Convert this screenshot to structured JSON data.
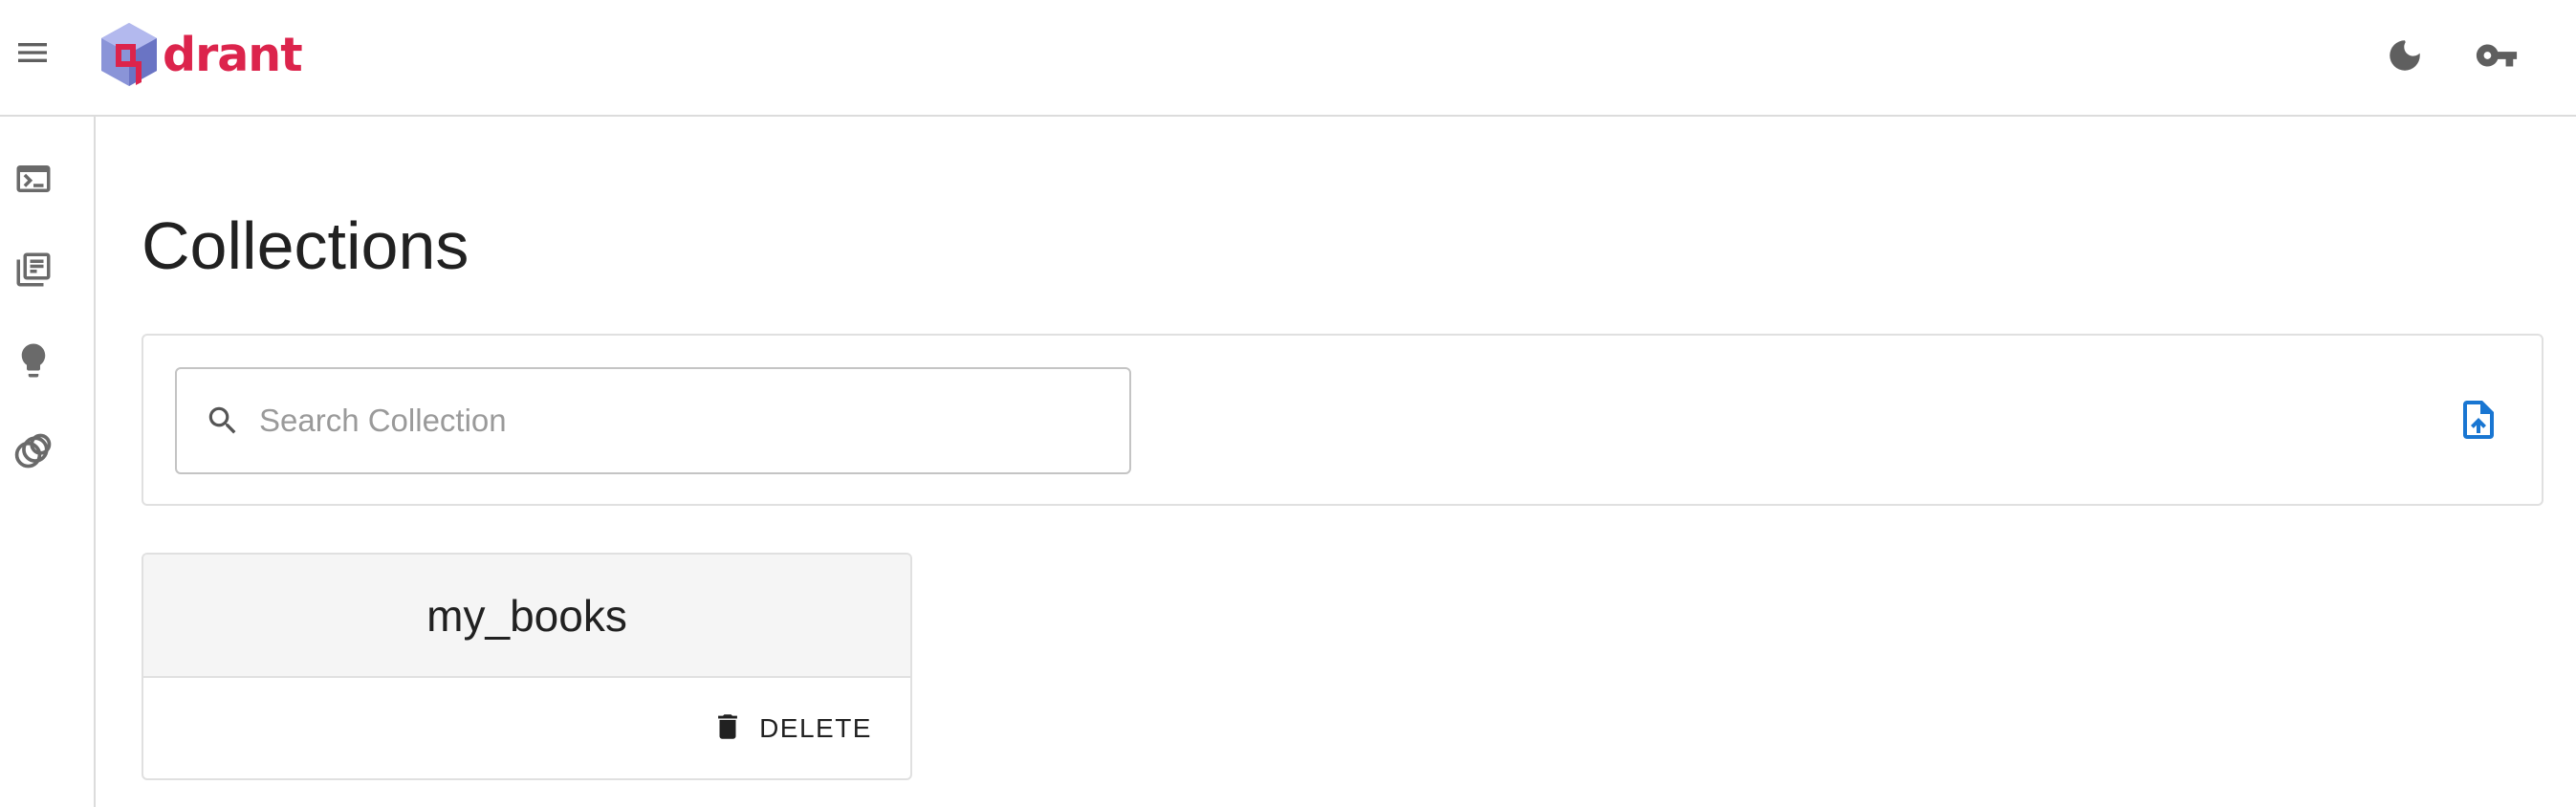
{
  "header": {
    "logo_text": "drant",
    "icons": {
      "menu": "hamburger-menu-icon",
      "theme": "dark-mode-moon-icon",
      "api_key": "key-icon"
    }
  },
  "sidebar": {
    "items": [
      {
        "name": "console",
        "icon": "terminal-icon"
      },
      {
        "name": "collections",
        "icon": "library-books-icon"
      },
      {
        "name": "tutorial",
        "icon": "lightbulb-icon"
      },
      {
        "name": "datasets",
        "icon": "rings-icon"
      }
    ]
  },
  "main": {
    "title": "Collections",
    "search": {
      "placeholder": "Search Collection",
      "value": ""
    },
    "upload_icon": "upload-file-icon",
    "collections": [
      {
        "name": "my_books",
        "delete_label": "DELETE"
      }
    ]
  },
  "colors": {
    "brand_red": "#dc244c",
    "brand_blue": "#1976d2",
    "icon_grey": "#616161",
    "border": "#e0e0e0"
  }
}
